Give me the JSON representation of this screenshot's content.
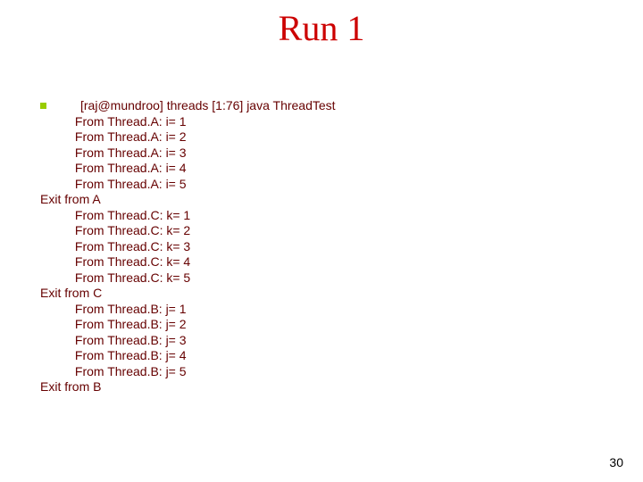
{
  "title": "Run 1",
  "command": "[raj@mundroo] threads [1:76] java ThreadTest",
  "blocks": [
    {
      "lines": [
        "From Thread.A: i= 1",
        "From Thread.A: i= 2",
        "From Thread.A: i= 3",
        "From Thread.A: i= 4",
        "From Thread.A: i= 5"
      ],
      "exit": "Exit from A"
    },
    {
      "lines": [
        "From Thread.C: k= 1",
        "From Thread.C: k= 2",
        "From Thread.C: k= 3",
        "From Thread.C: k= 4",
        "From Thread.C: k= 5"
      ],
      "exit": "Exit from C"
    },
    {
      "lines": [
        "From Thread.B: j= 1",
        "From Thread.B: j= 2",
        "From Thread.B: j= 3",
        "From Thread.B: j= 4",
        "From Thread.B: j= 5"
      ],
      "exit": "Exit from B"
    }
  ],
  "page_number": "30"
}
